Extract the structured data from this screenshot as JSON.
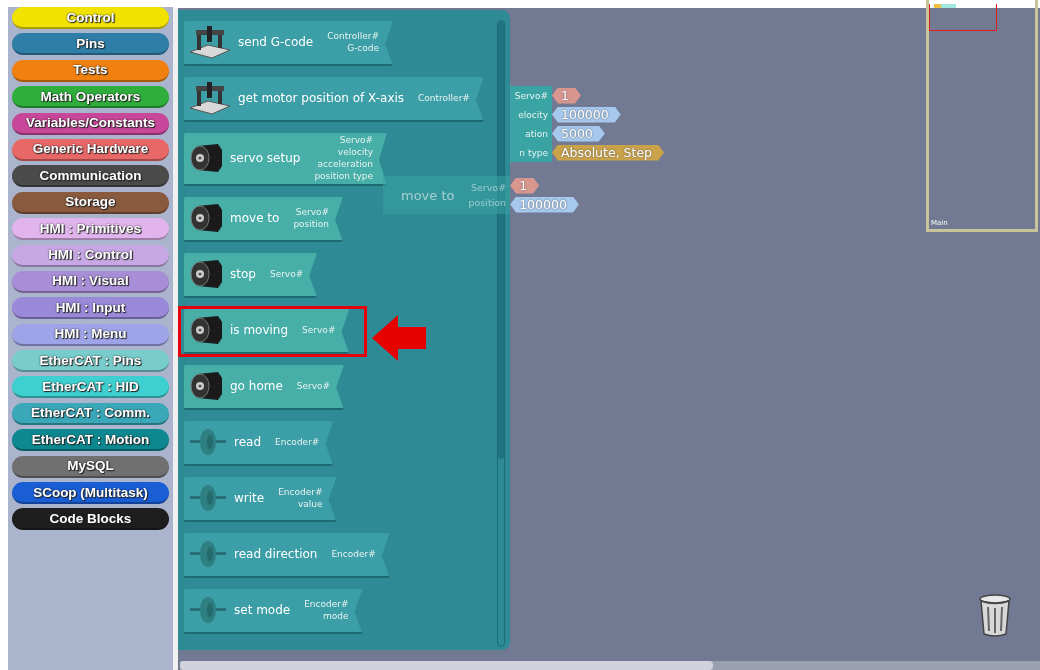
{
  "categories": [
    {
      "label": "Control",
      "color": "#f2e200"
    },
    {
      "label": "Pins",
      "color": "#2f7ea8"
    },
    {
      "label": "Tests",
      "color": "#f08010"
    },
    {
      "label": "Math Operators",
      "color": "#2fae3c"
    },
    {
      "label": "Variables/Constants",
      "color": "#c8479a"
    },
    {
      "label": "Generic Hardware",
      "color": "#e86868"
    },
    {
      "label": "Communication",
      "color": "#4a4a4a"
    },
    {
      "label": "Storage",
      "color": "#8a5a3e"
    },
    {
      "label": "HMI : Primitives",
      "color": "#e2b4ee"
    },
    {
      "label": "HMI : Control",
      "color": "#c8a8e4"
    },
    {
      "label": "HMI : Visual",
      "color": "#a88ed6"
    },
    {
      "label": "HMI : Input",
      "color": "#9a88d8"
    },
    {
      "label": "HMI : Menu",
      "color": "#9ea4e8"
    },
    {
      "label": "EtherCAT : Pins",
      "color": "#78cccc"
    },
    {
      "label": "EtherCAT : HID",
      "color": "#3ed0d0"
    },
    {
      "label": "EtherCAT : Comm.",
      "color": "#3aa8b8"
    },
    {
      "label": "EtherCAT : Motion",
      "color": "#0e8890"
    },
    {
      "label": "MySQL",
      "color": "#707070"
    },
    {
      "label": "SCoop (Multitask)",
      "color": "#1a5ed6"
    },
    {
      "label": "Code Blocks",
      "color": "#1e1e1e"
    }
  ],
  "palette": {
    "blocks": [
      {
        "kind": "controller",
        "label": "send G-code",
        "params": [
          "Controller#",
          "G-code"
        ],
        "highlighted": false
      },
      {
        "kind": "controller",
        "label": "get motor position of X-axis",
        "params": [
          "Controller#"
        ],
        "highlighted": false
      },
      {
        "kind": "servo",
        "label": "servo setup",
        "params": [
          "Servo#",
          "velocity",
          "acceleration",
          "position type"
        ],
        "highlighted": false
      },
      {
        "kind": "servo",
        "label": "move to",
        "params": [
          "Servo#",
          "position"
        ],
        "highlighted": false
      },
      {
        "kind": "servo",
        "label": "stop",
        "params": [
          "Servo#"
        ],
        "highlighted": false
      },
      {
        "kind": "servo",
        "label": "is moving",
        "params": [
          "Servo#"
        ],
        "highlighted": true
      },
      {
        "kind": "servo",
        "label": "go home",
        "params": [
          "Servo#"
        ],
        "highlighted": false
      },
      {
        "kind": "encoder",
        "label": "read",
        "params": [
          "Encoder#"
        ],
        "highlighted": false
      },
      {
        "kind": "encoder",
        "label": "write",
        "params": [
          "Encoder#",
          "value"
        ],
        "highlighted": false
      },
      {
        "kind": "encoder",
        "label": "read direction",
        "params": [
          "Encoder#"
        ],
        "highlighted": false
      },
      {
        "kind": "encoder",
        "label": "set mode",
        "params": [
          "Encoder#",
          "mode"
        ],
        "highlighted": false
      }
    ]
  },
  "canvas": {
    "setup_block": {
      "params": [
        {
          "label": "Servo#",
          "value": "1",
          "kind": "index"
        },
        {
          "label": "elocity",
          "value": "100000",
          "kind": "number"
        },
        {
          "label": "ation",
          "value": "5000",
          "kind": "number"
        },
        {
          "label": "n type",
          "value": "Absolute, Step",
          "kind": "option"
        }
      ]
    },
    "dragged_block": {
      "label": "move to",
      "params": [
        {
          "label": "Servo#",
          "value": "1",
          "kind": "index"
        },
        {
          "label": "position",
          "value": "100000",
          "kind": "number"
        }
      ]
    },
    "minimap": {
      "label": "Main"
    }
  }
}
